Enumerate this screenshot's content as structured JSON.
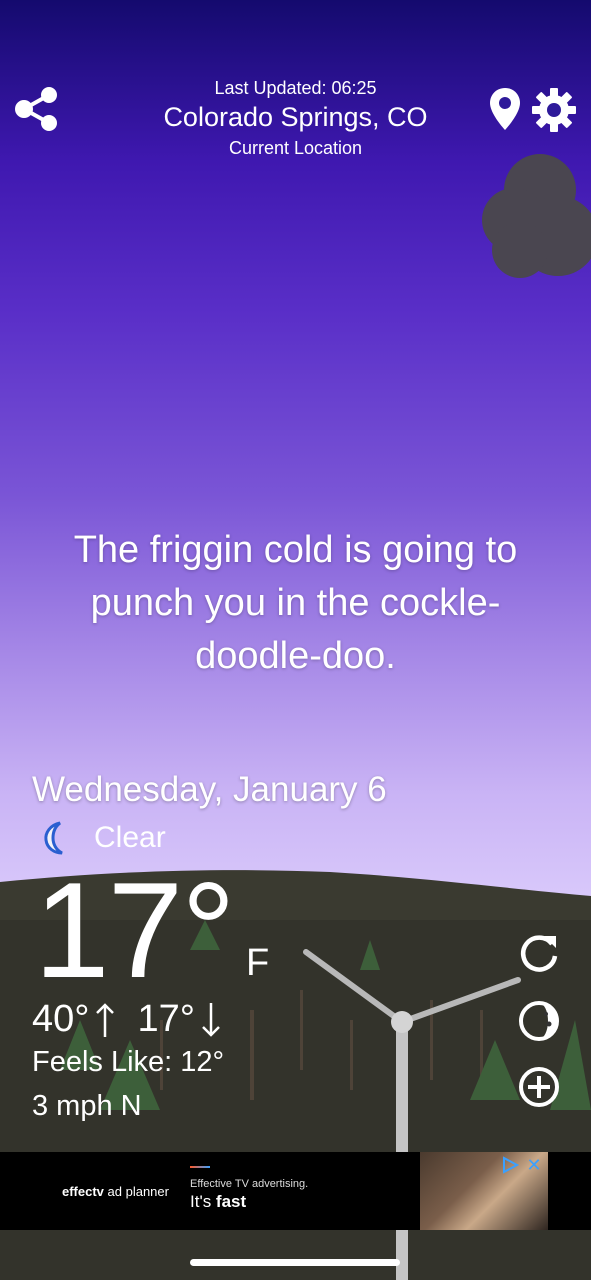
{
  "header": {
    "last_updated": "Last Updated: 06:25",
    "city": "Colorado Springs, CO",
    "location_label": "Current Location"
  },
  "icons": [
    "share-icon",
    "location-pin-icon",
    "gear-icon",
    "moon-icon",
    "refresh-icon",
    "moon-phase-icon",
    "plus-circle-icon",
    "ad-play-icon",
    "ad-close-icon"
  ],
  "tagline": [
    "The friggin cold is going to",
    "punch you in the cockle-",
    "doodle-doo."
  ],
  "weather": {
    "date": "Wednesday, January 6",
    "condition": "Clear",
    "temperature": "17°",
    "unit": "F",
    "high": "40°",
    "low": "17°",
    "feels_like": "Feels Like: 12°",
    "wind": "3 mph N"
  },
  "ad": {
    "brand_bold": "effectv",
    "brand_rest": " ad planner",
    "tagline_small": "Effective TV advertising.",
    "tagline_big_prefix": "It's ",
    "tagline_big_bold": "fast",
    "close": "✕"
  },
  "colors": {
    "sky_top": "#140a6e",
    "sky_bottom": "#d9c9fb",
    "ground": "#2a2a24",
    "ad_accent": "#3aa0ff"
  }
}
